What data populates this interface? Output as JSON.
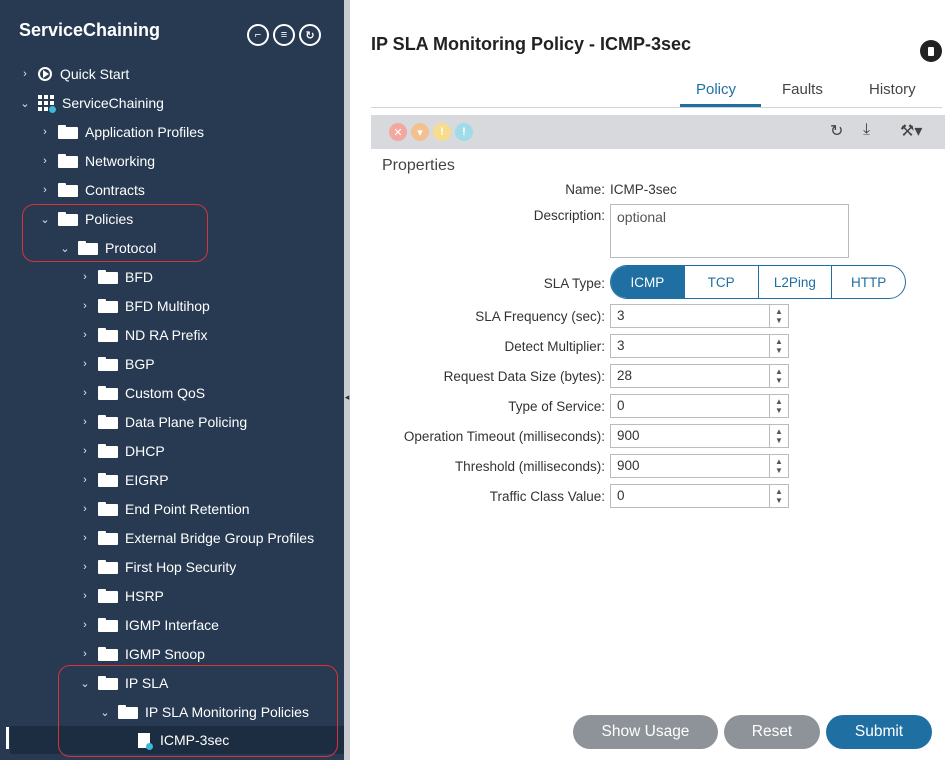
{
  "sidebar": {
    "title": "ServiceChaining",
    "header_icons": [
      "user-icon",
      "list-icon",
      "refresh-icon"
    ],
    "items": [
      {
        "label": "Quick Start",
        "icon": "play-circle-icon",
        "expanded": false
      },
      {
        "label": "ServiceChaining",
        "icon": "tenant-grid-icon",
        "expanded": true
      },
      {
        "label": "Application Profiles",
        "icon": "folder-icon",
        "expanded": false
      },
      {
        "label": "Networking",
        "icon": "folder-icon",
        "expanded": false
      },
      {
        "label": "Contracts",
        "icon": "folder-icon",
        "expanded": false
      },
      {
        "label": "Policies",
        "icon": "folder-icon",
        "expanded": true
      },
      {
        "label": "Protocol",
        "icon": "folder-icon",
        "expanded": true
      },
      {
        "label": "BFD",
        "icon": "folder-icon",
        "expanded": false
      },
      {
        "label": "BFD Multihop",
        "icon": "folder-icon",
        "expanded": false
      },
      {
        "label": "ND RA Prefix",
        "icon": "folder-icon",
        "expanded": false
      },
      {
        "label": "BGP",
        "icon": "folder-icon",
        "expanded": false
      },
      {
        "label": "Custom QoS",
        "icon": "folder-icon",
        "expanded": false
      },
      {
        "label": "Data Plane Policing",
        "icon": "folder-icon",
        "expanded": false
      },
      {
        "label": "DHCP",
        "icon": "folder-icon",
        "expanded": false
      },
      {
        "label": "EIGRP",
        "icon": "folder-icon",
        "expanded": false
      },
      {
        "label": "End Point Retention",
        "icon": "folder-icon",
        "expanded": false
      },
      {
        "label": "External Bridge Group Profiles",
        "icon": "folder-icon",
        "expanded": false
      },
      {
        "label": "First Hop Security",
        "icon": "folder-icon",
        "expanded": false
      },
      {
        "label": "HSRP",
        "icon": "folder-icon",
        "expanded": false
      },
      {
        "label": "IGMP Interface",
        "icon": "folder-icon",
        "expanded": false
      },
      {
        "label": "IGMP Snoop",
        "icon": "folder-icon",
        "expanded": false
      },
      {
        "label": "IP SLA",
        "icon": "folder-icon",
        "expanded": true
      },
      {
        "label": "IP SLA Monitoring Policies",
        "icon": "folder-icon",
        "expanded": true
      },
      {
        "label": "ICMP-3sec",
        "icon": "policy-doc-icon",
        "selected": true
      }
    ]
  },
  "main": {
    "title": "IP SLA Monitoring Policy - ICMP-3sec",
    "tabs": [
      {
        "label": "Policy",
        "active": true
      },
      {
        "label": "Faults",
        "active": false
      },
      {
        "label": "History",
        "active": false
      }
    ],
    "fault_colors": [
      "#f2a7a0",
      "#f4c08f",
      "#f6dc8c",
      "#9fdbe9"
    ],
    "toolbar_tools": [
      "refresh-icon",
      "download-icon",
      "tools-icon"
    ],
    "properties_label": "Properties",
    "name_label": "Name:",
    "name_value": "ICMP-3sec",
    "description_label": "Description:",
    "description_placeholder": "optional",
    "sla_type_label": "SLA Type:",
    "sla_types": [
      {
        "label": "ICMP",
        "active": true
      },
      {
        "label": "TCP",
        "active": false
      },
      {
        "label": "L2Ping",
        "active": false
      },
      {
        "label": "HTTP",
        "active": false
      }
    ],
    "fields": [
      {
        "label": "SLA Frequency (sec):",
        "value": "3"
      },
      {
        "label": "Detect Multiplier:",
        "value": "3"
      },
      {
        "label": "Request Data Size (bytes):",
        "value": "28"
      },
      {
        "label": "Type of Service:",
        "value": "0"
      },
      {
        "label": "Operation Timeout (milliseconds):",
        "value": "900"
      },
      {
        "label": "Threshold (milliseconds):",
        "value": "900"
      },
      {
        "label": "Traffic Class Value:",
        "value": "0"
      }
    ],
    "buttons": {
      "show_usage": "Show Usage",
      "reset": "Reset",
      "submit": "Submit"
    },
    "colors": {
      "accent": "#1f6fa3",
      "sidebar_bg": "#273a52",
      "highlight_box": "#d8333a"
    }
  }
}
